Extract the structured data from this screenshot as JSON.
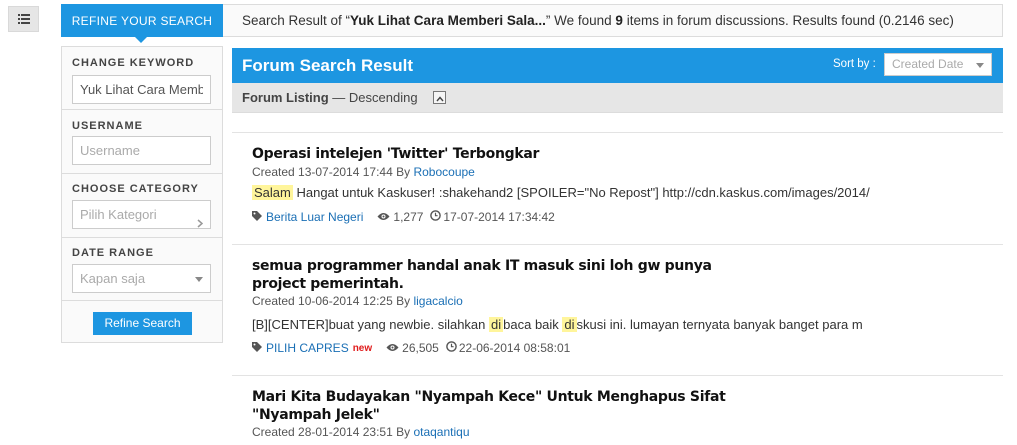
{
  "top_bar": {
    "refine_tab": "REFINE YOUR SEARCH",
    "summary_prefix": "Search Result of “",
    "summary_query": "Yuk Lihat Cara Memberi Sala...",
    "summary_mid": "” We found ",
    "summary_count": "9",
    "summary_suffix": " items in forum discussions. Results found (0.2146 sec)"
  },
  "sidebar": {
    "keyword_label": "CHANGE KEYWORD",
    "keyword_value": "Yuk Lihat Cara Memberi",
    "username_label": "USERNAME",
    "username_placeholder": "Username",
    "category_label": "CHOOSE CATEGORY",
    "category_placeholder": "Pilih Kategori",
    "date_label": "DATE RANGE",
    "date_value": "Kapan saja",
    "refine_button": "Refine Search"
  },
  "panel": {
    "title": "Forum Search Result",
    "sort_label": "Sort by :",
    "sort_value": "Created Date",
    "listing_label": "Forum Listing",
    "listing_order": " — Descending"
  },
  "results": [
    {
      "title_line1": "Operasi intelejen 'Twitter' Terbongkar",
      "title_line2": "",
      "created": "Created 13-07-2014 17:44 By ",
      "author": "Robocoupe",
      "snippet_parts": [
        {
          "text": "Salam",
          "hl": true
        },
        {
          "text": " Hangat untuk Kaskuser! :shakehand2 [SPOILER=\"No Repost\"] http://cdn.kaskus.com/images/2014/",
          "hl": false
        }
      ],
      "category": "Berita Luar Negeri",
      "new_badge": "",
      "views": "1,277",
      "last_date": "17-07-2014 17:34:42"
    },
    {
      "title_line1": "semua programmer handal anak IT masuk sini loh gw punya",
      "title_line2": "project pemerintah.",
      "created": "Created 10-06-2014 12:25 By ",
      "author": "ligacalcio",
      "snippet_parts": [
        {
          "text": "[B][CENTER]buat yang newbie. silahkan ",
          "hl": false
        },
        {
          "text": "di",
          "hl": true
        },
        {
          "text": "baca baik ",
          "hl": false
        },
        {
          "text": "di",
          "hl": true
        },
        {
          "text": "skusi ini. lumayan ternyata banyak banget para m",
          "hl": false
        }
      ],
      "category": "PILIH CAPRES",
      "new_badge": "new",
      "views": "26,505",
      "last_date": "22-06-2014 08:58:01"
    },
    {
      "title_line1": "Mari Kita Budayakan \"Nyampah Kece\" Untuk Menghapus Sifat",
      "title_line2": "\"Nyampah Jelek\"",
      "created": "Created 28-01-2014 23:51 By ",
      "author": "otaqantiqu"
    }
  ],
  "icons": {
    "menu": "list-icon",
    "tag": "tag-icon",
    "views": "eye-icon",
    "clock": "clock-icon",
    "collapse": "chevron-up-icon",
    "category_arrow": "chevron-right-icon",
    "dropdown": "caret-down-icon"
  },
  "colors": {
    "accent": "#1d96e1",
    "link": "#1a6fb5",
    "highlight": "#fff59b",
    "new_badge": "#e01b1b"
  }
}
